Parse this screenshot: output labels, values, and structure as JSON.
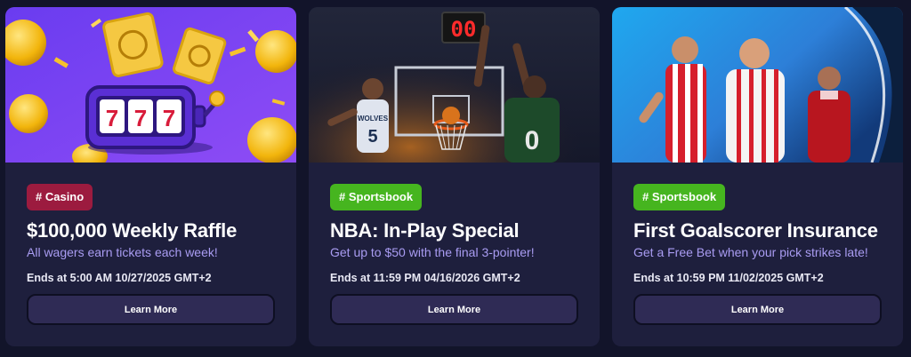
{
  "colors": {
    "page_bg": "#12142a",
    "card_bg": "#1e1f3d",
    "casino_tag": "#9c1b3f",
    "sportsbook_tag": "#46b51f",
    "subtitle": "#a99cf2",
    "button_bg": "#2f2b55"
  },
  "promotions": [
    {
      "tag": "# Casino",
      "tag_color": "#9c1b3f",
      "title": "$100,000 Weekly Raffle",
      "subtitle": "All wagers earn tickets each week!",
      "ends": "Ends at 5:00 AM 10/27/2025 GMT+2",
      "button": "Learn More",
      "hero": {
        "slot_text": "777",
        "icon": "slot-machine-icon"
      }
    },
    {
      "tag": "# Sportsbook",
      "tag_color": "#46b51f",
      "title": "NBA: In-Play Special",
      "subtitle": "Get up to $50 with the final 3-pointer!",
      "ends": "Ends at 11:59 PM 04/16/2026 GMT+2",
      "button": "Learn More",
      "hero": {
        "shot_clock": "00",
        "player_a_jersey": "WOLVES",
        "player_a_number": "5",
        "player_b_number": "0"
      }
    },
    {
      "tag": "# Sportsbook",
      "tag_color": "#46b51f",
      "title": "First Goalscorer Insurance",
      "subtitle": "Get a Free Bet when your pick strikes late!",
      "ends": "Ends at 10:59 PM 11/02/2025 GMT+2",
      "button": "Learn More",
      "hero": {
        "icon": "soccer-players-image"
      }
    }
  ]
}
